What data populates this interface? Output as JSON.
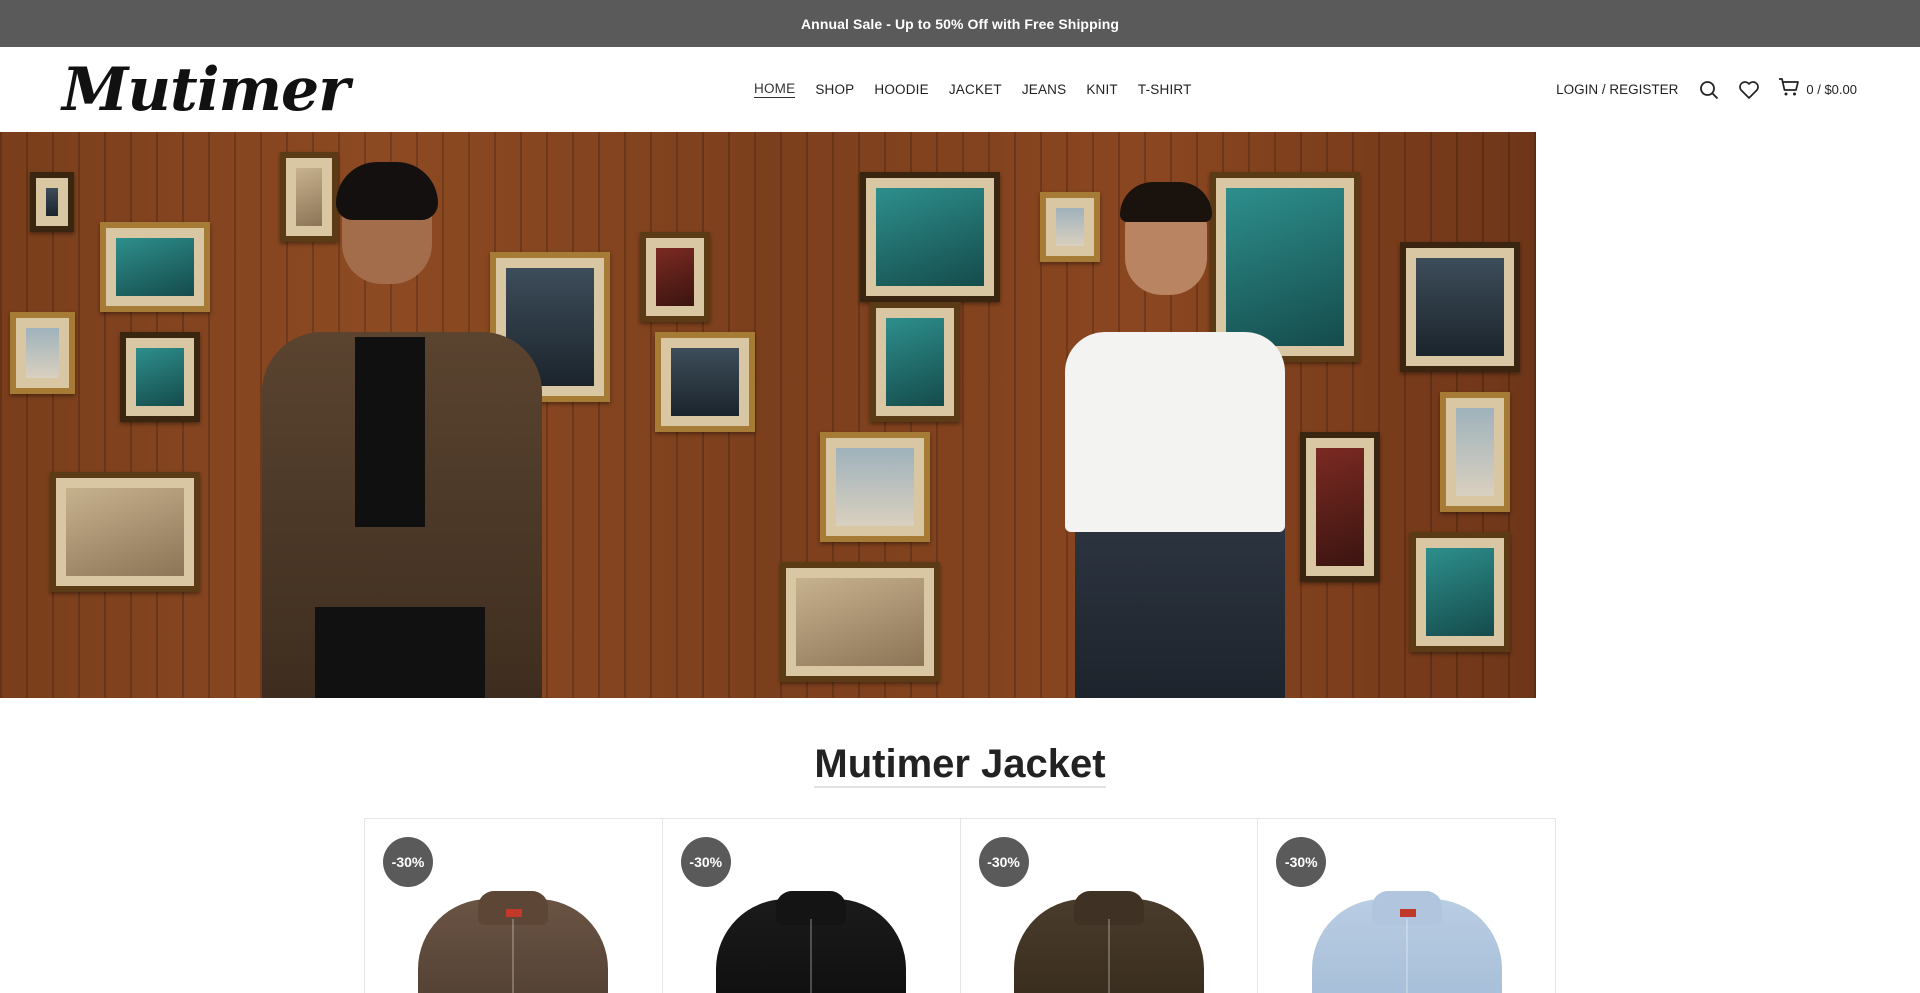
{
  "announcement": {
    "text": "Annual Sale - Up to 50% Off with Free Shipping"
  },
  "header": {
    "logo": "Mutimer",
    "nav": [
      {
        "label": "HOME",
        "active": true
      },
      {
        "label": "SHOP",
        "active": false
      },
      {
        "label": "HOODIE",
        "active": false
      },
      {
        "label": "JACKET",
        "active": false
      },
      {
        "label": "JEANS",
        "active": false
      },
      {
        "label": "KNIT",
        "active": false
      },
      {
        "label": "T-SHIRT",
        "active": false
      }
    ],
    "login_label": "LOGIN / REGISTER",
    "icons": [
      "search-icon",
      "heart-icon",
      "cart-icon"
    ],
    "cart_summary": "0 / $0.00"
  },
  "section": {
    "title": "Mutimer Jacket"
  },
  "products": [
    {
      "badge": "-30%",
      "color": "brown"
    },
    {
      "badge": "-30%",
      "color": "black"
    },
    {
      "badge": "-30%",
      "color": "olive"
    },
    {
      "badge": "-30%",
      "color": "denim"
    }
  ],
  "colors": {
    "topbar": "#5a5a5a",
    "badge": "#5a5a5a",
    "text": "#222222"
  }
}
